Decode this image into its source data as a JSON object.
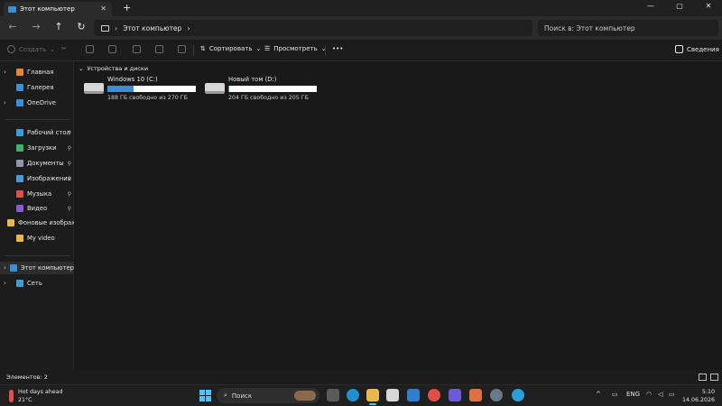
{
  "window": {
    "tab_title": "Этот компьютер",
    "new_tab": "+",
    "minimize": "—",
    "maximize": "▢",
    "close": "✕",
    "tab_close": "✕"
  },
  "nav": {
    "back": "←",
    "forward": "→",
    "up": "↑",
    "refresh": "↻",
    "breadcrumb_sep": "›",
    "breadcrumb": "Этот компьютер",
    "search_placeholder": "Поиск в: Этот компьютер"
  },
  "toolbar": {
    "create": "Создать",
    "sort": "Сортировать",
    "view": "Просмотреть",
    "more": "•••",
    "details": "Сведения"
  },
  "sidebar": {
    "items": [
      {
        "label": "Главная",
        "icon": "home-icon",
        "color": "#e0863a",
        "pinned": false,
        "chevron": "›"
      },
      {
        "label": "Галерея",
        "icon": "gallery-icon",
        "color": "#3a8fd6",
        "pinned": false,
        "chevron": ""
      },
      {
        "label": "OneDrive",
        "icon": "cloud-icon",
        "color": "#3a8fd6",
        "pinned": false,
        "chevron": "›"
      },
      {
        "label": "Рабочий стол",
        "icon": "desktop-icon",
        "color": "#3aa0d8",
        "pinned": true,
        "chevron": ""
      },
      {
        "label": "Загрузки",
        "icon": "download-icon",
        "color": "#3fb36b",
        "pinned": true,
        "chevron": ""
      },
      {
        "label": "Документы",
        "icon": "document-icon",
        "color": "#8f98a8",
        "pinned": true,
        "chevron": ""
      },
      {
        "label": "Изображения",
        "icon": "pictures-icon",
        "color": "#4a9ad8",
        "pinned": true,
        "chevron": ""
      },
      {
        "label": "Музыка",
        "icon": "music-icon",
        "color": "#e0504a",
        "pinned": true,
        "chevron": ""
      },
      {
        "label": "Видео",
        "icon": "video-icon",
        "color": "#8a5ad8",
        "pinned": true,
        "chevron": ""
      },
      {
        "label": "Фоновые изображения",
        "icon": "folder-icon",
        "color": "#e8b84a",
        "pinned": false,
        "chevron": ""
      },
      {
        "label": "My video",
        "icon": "folder-icon",
        "color": "#e8b84a",
        "pinned": false,
        "chevron": ""
      },
      {
        "label": "Этот компьютер",
        "icon": "computer-icon",
        "color": "#3a8fd6",
        "pinned": false,
        "chevron": "›"
      },
      {
        "label": "Сеть",
        "icon": "network-icon",
        "color": "#3aa0d8",
        "pinned": false,
        "chevron": "›"
      }
    ],
    "pin_glyph": "📌"
  },
  "content": {
    "group_label": "Устройства и диски",
    "group_chevron": "⌄",
    "drives": [
      {
        "name": "Windows 10 (C:)",
        "free": "188 ГБ свободно из 270 ГБ",
        "used_fraction": 0.3,
        "icon": "windows-drive-icon"
      },
      {
        "name": "Новый том (D:)",
        "free": "204 ГБ свободно из 205 ГБ",
        "used_fraction": 0.005,
        "icon": "drive-icon"
      }
    ]
  },
  "status": {
    "items": "Элементов: 2"
  },
  "taskbar": {
    "weather_title": "Hot days ahead",
    "weather_temp": "21°C",
    "search": "Поиск",
    "lang": "ENG",
    "time": "5:10",
    "date": "14.06.2026",
    "tray_chevron": "^"
  }
}
